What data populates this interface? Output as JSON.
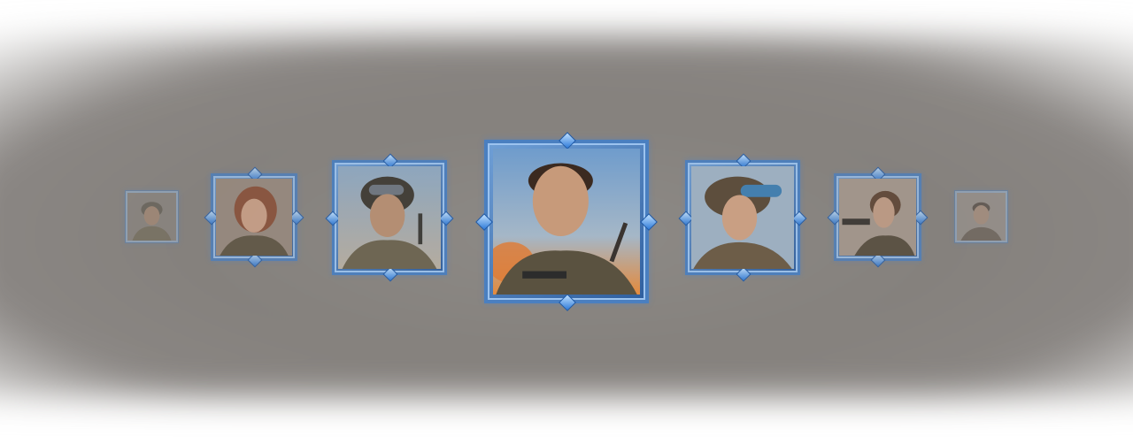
{
  "carousel": {
    "selected_index": 3,
    "items": [
      {
        "name": "soldier-helmet-small",
        "sky": "#8a8680",
        "accent": "#6b5a45"
      },
      {
        "name": "female-soldier-redhair",
        "sky": "#9a8a7c",
        "accent": "#8a4a30"
      },
      {
        "name": "soldier-goggles-helmet",
        "sky": "#8fa6bf",
        "accent": "#4a4436"
      },
      {
        "name": "male-soldier-center",
        "sky": "#7fa6cf",
        "accent": "#e0823a"
      },
      {
        "name": "female-soldier-goggles",
        "sky": "#9fb4c8",
        "accent": "#5a4a38"
      },
      {
        "name": "female-soldier-rifle",
        "sky": "#a8998c",
        "accent": "#5a4a3c"
      },
      {
        "name": "male-soldier-small",
        "sky": "#a39c96",
        "accent": "#5d5043"
      }
    ]
  },
  "colors": {
    "frame_blue": "#4a7fc0",
    "frame_highlight": "#9cc3ef",
    "gem_blue": "#2e7ad8",
    "background_band": "#8a8683"
  }
}
